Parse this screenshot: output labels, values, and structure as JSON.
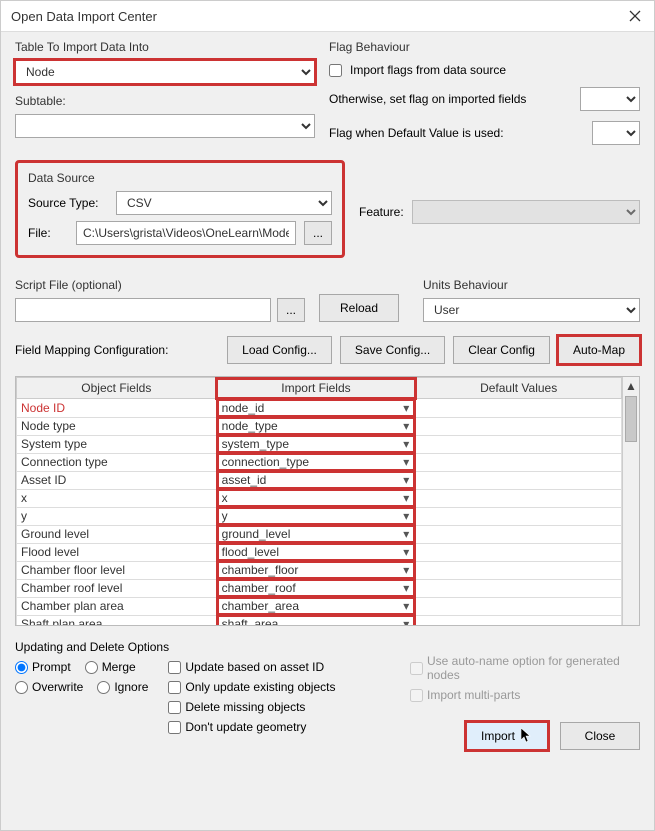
{
  "window": {
    "title": "Open Data Import Center"
  },
  "table_into": {
    "label": "Table To Import Data Into",
    "value": "Node",
    "subtable_label": "Subtable:"
  },
  "flag": {
    "heading": "Flag Behaviour",
    "import_flags": "Import flags from data source",
    "otherwise": "Otherwise, set flag on imported fields",
    "default_flag": "Flag when Default Value is used:"
  },
  "data_source": {
    "heading": "Data Source",
    "source_type_label": "Source Type:",
    "source_type_value": "CSV",
    "file_label": "File:",
    "file_value": "C:\\Users\\grista\\Videos\\OneLearn\\Model D",
    "browse": "...",
    "feature_label": "Feature:"
  },
  "script": {
    "label": "Script File (optional)",
    "browse": "...",
    "reload": "Reload"
  },
  "units": {
    "heading": "Units Behaviour",
    "value": "User"
  },
  "fmc": {
    "label": "Field Mapping Configuration:",
    "load": "Load Config...",
    "save": "Save Config...",
    "clear": "Clear Config",
    "automap": "Auto-Map"
  },
  "table": {
    "headers": {
      "object": "Object Fields",
      "import": "Import Fields",
      "default": "Default Values"
    },
    "rows": [
      {
        "object": "Node ID",
        "import": "node_id",
        "primary": true
      },
      {
        "object": "Node type",
        "import": "node_type"
      },
      {
        "object": "System type",
        "import": "system_type"
      },
      {
        "object": "Connection type",
        "import": "connection_type"
      },
      {
        "object": "Asset ID",
        "import": "asset_id"
      },
      {
        "object": "x",
        "import": "x"
      },
      {
        "object": "y",
        "import": "y"
      },
      {
        "object": "Ground level",
        "import": "ground_level"
      },
      {
        "object": "Flood level",
        "import": "flood_level"
      },
      {
        "object": "Chamber floor level",
        "import": "chamber_floor"
      },
      {
        "object": "Chamber roof level",
        "import": "chamber_roof"
      },
      {
        "object": "Chamber plan area",
        "import": "chamber_area"
      },
      {
        "object": "Shaft plan area",
        "import": "shaft_area"
      }
    ]
  },
  "updating": {
    "heading": "Updating and Delete Options",
    "prompt": "Prompt",
    "merge": "Merge",
    "overwrite": "Overwrite",
    "ignore": "Ignore",
    "update_asset": "Update based on asset ID",
    "only_update": "Only update existing objects",
    "delete_missing": "Delete missing objects",
    "dont_update_geom": "Don't update geometry"
  },
  "extra": {
    "autoname": "Use auto-name option for generated nodes",
    "multiparts": "Import multi-parts"
  },
  "footer": {
    "import": "Import",
    "close": "Close"
  }
}
